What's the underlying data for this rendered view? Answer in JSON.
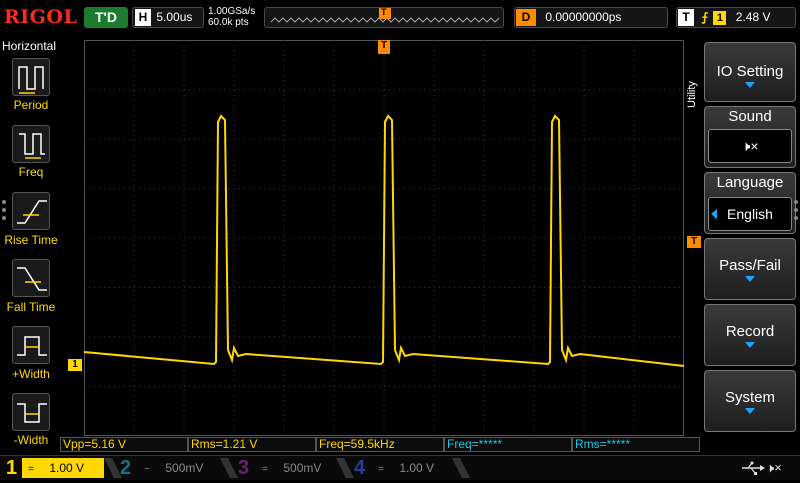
{
  "brand": "RIGOL",
  "status": "T'D",
  "timebase": {
    "label": "H",
    "value": "5.00us"
  },
  "sample": {
    "rate": "1.00GSa/s",
    "points": "60.0k pts"
  },
  "memory_marker": "T",
  "delay": {
    "label": "D",
    "value": "0.00000000ps"
  },
  "trigger": {
    "label": "T",
    "source": "1",
    "level": "2.48 V"
  },
  "left_menu": {
    "title": "Horizontal",
    "items": [
      {
        "id": "period",
        "label": "Period"
      },
      {
        "id": "freq",
        "label": "Freq"
      },
      {
        "id": "rise",
        "label": "Rise Time"
      },
      {
        "id": "fall",
        "label": "Fall Time"
      },
      {
        "id": "pwidth",
        "label": "+Width"
      },
      {
        "id": "nwidth",
        "label": "-Width"
      }
    ]
  },
  "right_menu": {
    "tab": "Utility",
    "io_setting": "IO Setting",
    "sound": {
      "title": "Sound",
      "icon": "speaker-muted-icon"
    },
    "language": {
      "title": "Language",
      "value": "English"
    },
    "pass_fail": "Pass/Fail",
    "record": "Record",
    "system": "System"
  },
  "markers": {
    "ch1_ground": "1",
    "trigger_level": "T",
    "trigger_pos": "T"
  },
  "measurements": [
    {
      "text": "Vpp=5.16 V",
      "channel": "ch1"
    },
    {
      "text": "Rms=1.21 V",
      "channel": "ch1"
    },
    {
      "text": "Freq=59.5kHz",
      "channel": "ch1"
    },
    {
      "text": "Freq=*****",
      "channel": "off"
    },
    {
      "text": "Rms=*****",
      "channel": "off"
    }
  ],
  "channels": [
    {
      "num": "1",
      "coupling": "=",
      "scale": "1.00 V",
      "color": "#ffd800",
      "active": true
    },
    {
      "num": "2",
      "coupling": "~",
      "scale": "500mV",
      "color": "#19c8e6",
      "active": false
    },
    {
      "num": "3",
      "coupling": "=",
      "scale": "500mV",
      "color": "#c030c0",
      "active": false
    },
    {
      "num": "4",
      "coupling": "=",
      "scale": "1.00 V",
      "color": "#3070ff",
      "active": false
    }
  ],
  "colors": {
    "ch1": "#ffd800",
    "accent": "#ff8c00",
    "grid": "#3a3a3a"
  },
  "icons": [
    "usb-icon",
    "speaker-muted-icon"
  ]
}
